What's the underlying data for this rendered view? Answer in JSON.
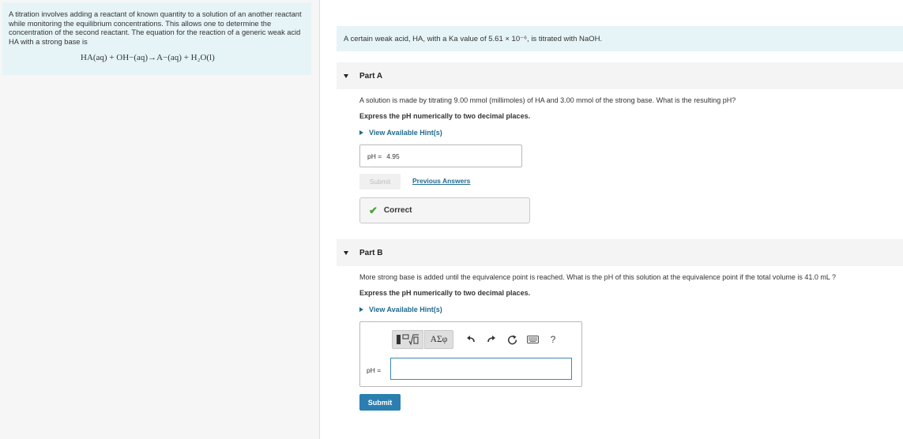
{
  "intro": {
    "text": "A titration involves adding a reactant of known quantity to a solution of an another reactant while monitoring the equilibrium concentrations. This allows one to determine the concentration of the second reactant. The equation for the reaction of a generic weak acid HA with a strong base is",
    "equation": "HA(aq) + OH−(aq)→A−(aq) + H₂O(l)"
  },
  "problem": {
    "statement": "A certain weak acid, HA, with a Ka value of 5.61 × 10⁻⁶, is titrated with NaOH."
  },
  "part_a": {
    "title": "Part A",
    "question": "A solution is made by titrating 9.00 mmol (millimoles) of HA and 3.00 mmol of the strong base. What is the resulting pH?",
    "instruction": "Express the pH numerically to two decimal places.",
    "hint_label": "View Available Hint(s)",
    "answer_label": "pH =",
    "answer_value": "4.95",
    "submit_label": "Submit",
    "previous_answers_label": "Previous Answers",
    "feedback": "Correct"
  },
  "part_b": {
    "title": "Part B",
    "question": "More strong base is added until the equivalence point is reached. What is the pH of this solution at the equivalence point if the total volume is 41.0 mL ?",
    "instruction": "Express the pH numerically to two decimal places.",
    "hint_label": "View Available Hint(s)",
    "toolbar": {
      "greek_label": "AΣφ",
      "help_label": "?",
      "icons": [
        "templates-icon",
        "greek-symbols-icon",
        "undo-icon",
        "redo-icon",
        "reset-icon",
        "keyboard-icon",
        "help-icon"
      ]
    },
    "answer_label": "pH =",
    "answer_value": "",
    "submit_label": "Submit"
  },
  "colors": {
    "accent": "#2b7fb0",
    "link": "#1f6a8f",
    "banner": "#e6f4f7",
    "correct": "#4ca23a"
  }
}
